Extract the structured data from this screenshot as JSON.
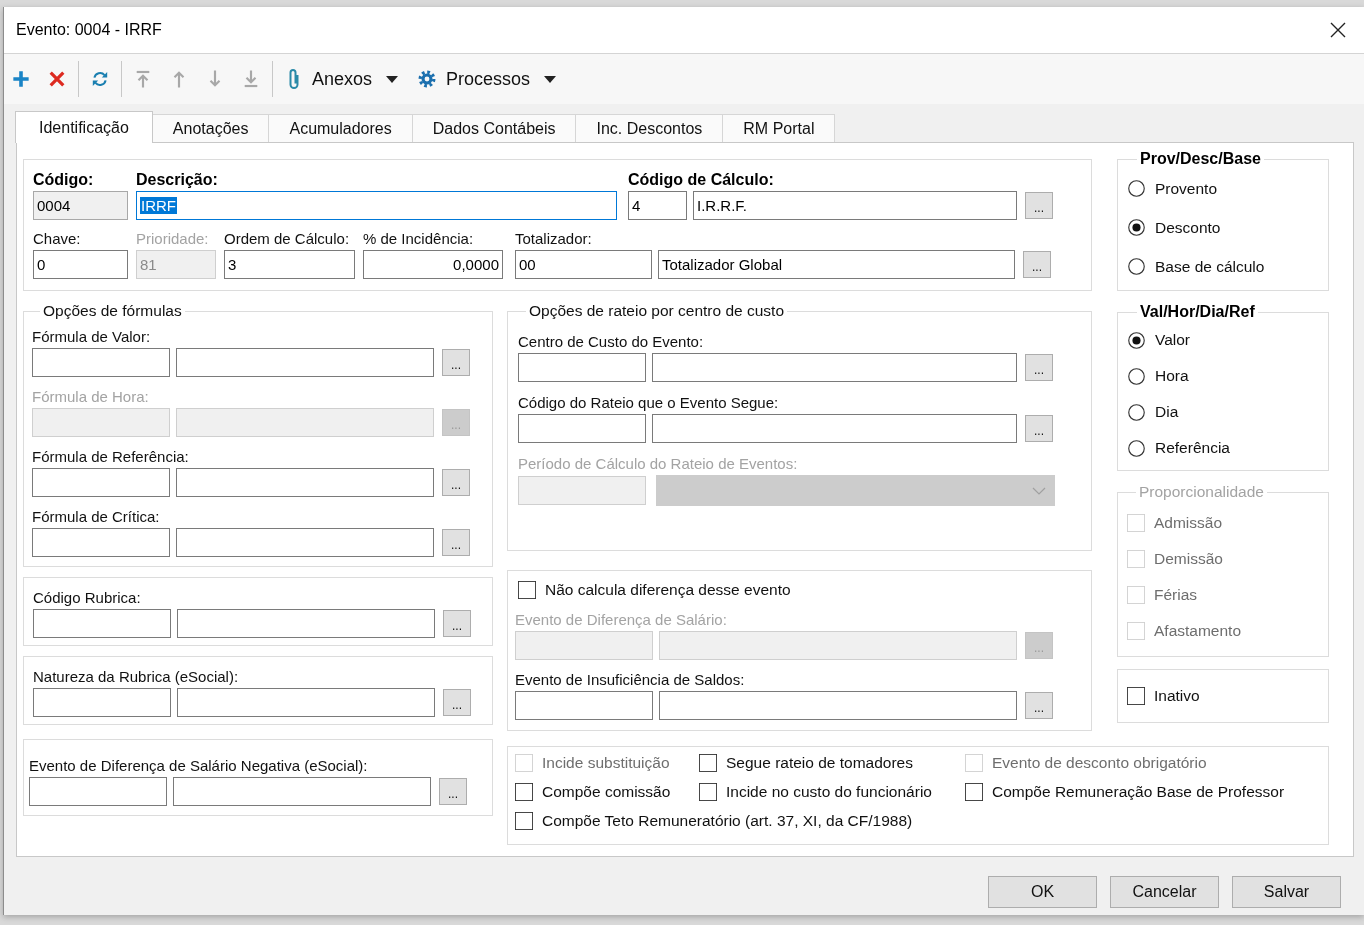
{
  "window": {
    "title": "Evento: 0004 - IRRF"
  },
  "toolbar": {
    "groups": [
      [
        {
          "kind": "add",
          "disabled": false
        },
        {
          "kind": "delete",
          "disabled": false
        }
      ],
      [
        {
          "kind": "refresh",
          "disabled": false
        }
      ],
      [
        {
          "kind": "move-first",
          "disabled": true
        },
        {
          "kind": "move-up",
          "disabled": true
        },
        {
          "kind": "move-down",
          "disabled": true
        },
        {
          "kind": "move-last",
          "disabled": true
        }
      ]
    ],
    "menus": [
      {
        "kind": "attachments",
        "label": "Anexos"
      },
      {
        "kind": "processes",
        "label": "Processos"
      }
    ]
  },
  "tabs": [
    {
      "label": "Identificação",
      "selected": true
    },
    {
      "label": "Anotações",
      "selected": false
    },
    {
      "label": "Acumuladores",
      "selected": false
    },
    {
      "label": "Dados Contábeis",
      "selected": false
    },
    {
      "label": "Inc. Descontos",
      "selected": false
    },
    {
      "label": "RM Portal",
      "selected": false
    }
  ],
  "identification": {
    "row_1": [
      {
        "kind": "text",
        "label": "Código:",
        "value": "0004",
        "readonly": true,
        "disabled": false
      },
      {
        "kind": "text",
        "label": "Descrição:",
        "value": "IRRF",
        "focused": true,
        "disabled": false
      },
      {
        "kind": "lookup",
        "label": "Código de Cálculo:",
        "code": "4",
        "description": "I.R.R.F.",
        "button": "...",
        "disabled": false
      }
    ],
    "row_2": [
      {
        "kind": "text",
        "label": "Chave:",
        "value": "0",
        "disabled": false
      },
      {
        "kind": "text",
        "label": "Prioridade:",
        "value": "81",
        "disabled": true
      },
      {
        "kind": "text",
        "label": "Ordem de Cálculo:",
        "value": "3",
        "disabled": false
      },
      {
        "kind": "number",
        "label": "% de Incidência:",
        "value": "0,0000",
        "disabled": false
      },
      {
        "kind": "lookup",
        "label": "Totalizador:",
        "code": "00",
        "description": "Totalizador Global",
        "button": "...",
        "disabled": false
      }
    ]
  },
  "left_groups": [
    {
      "title": "Opções de fórmulas",
      "fields": [
        {
          "kind": "lookup",
          "label": "Fórmula de Valor:",
          "button": "...",
          "disabled": false
        },
        {
          "kind": "lookup",
          "label": "Fórmula de Hora:",
          "button": "...",
          "disabled": true
        },
        {
          "kind": "lookup",
          "label": "Fórmula de Referência:",
          "button": "...",
          "disabled": false
        },
        {
          "kind": "lookup",
          "label": "Fórmula de Crítica:",
          "button": "...",
          "disabled": false
        }
      ]
    },
    {
      "fields": [
        {
          "kind": "lookup",
          "label": "Código Rubrica:",
          "button": "...",
          "disabled": false
        }
      ]
    },
    {
      "fields": [
        {
          "kind": "lookup",
          "label": "Natureza da Rubrica (eSocial):",
          "button": "...",
          "disabled": false
        }
      ]
    },
    {
      "fields": [
        {
          "kind": "lookup",
          "label": "Evento de Diferença de Salário Negativa (eSocial):",
          "button": "...",
          "disabled": false
        }
      ]
    }
  ],
  "middle_groups": [
    {
      "title": "Opções de rateio por centro de custo",
      "fields": [
        {
          "kind": "lookup",
          "label": "Centro de Custo do Evento:",
          "button": "...",
          "disabled": false
        },
        {
          "kind": "lookup",
          "label": "Código do Rateio que o Evento Segue:",
          "button": "...",
          "disabled": false
        },
        {
          "kind": "dropdown",
          "label": "Período de Cálculo do Rateio de Eventos:",
          "disabled": true
        }
      ]
    },
    {
      "checkbox": {
        "label": "Não calcula diferença desse evento",
        "checked": false
      },
      "fields": [
        {
          "kind": "lookup",
          "label": "Evento de Diferença de Salário:",
          "button": "...",
          "disabled": true
        },
        {
          "kind": "lookup",
          "label": "Evento de Insuficiência de Saldos:",
          "button": "...",
          "disabled": false
        }
      ]
    }
  ],
  "side_groups": [
    {
      "kind": "radio",
      "title": "Prov/Desc/Base",
      "disabled": false,
      "options": [
        {
          "label": "Provento",
          "selected": false
        },
        {
          "label": "Desconto",
          "selected": true
        },
        {
          "label": "Base de cálculo",
          "selected": false
        }
      ]
    },
    {
      "kind": "radio",
      "title": "Val/Hor/Dia/Ref",
      "disabled": false,
      "options": [
        {
          "label": "Valor",
          "selected": true
        },
        {
          "label": "Hora",
          "selected": false
        },
        {
          "label": "Dia",
          "selected": false
        },
        {
          "label": "Referência",
          "selected": false
        }
      ]
    },
    {
      "kind": "checkbox",
      "title": "Proporcionalidade",
      "disabled": true,
      "options": [
        {
          "label": "Admissão",
          "checked": false
        },
        {
          "label": "Demissão",
          "checked": false
        },
        {
          "label": "Férias",
          "checked": false
        },
        {
          "label": "Afastamento",
          "checked": false
        }
      ]
    },
    {
      "kind": "checkbox",
      "disabled": false,
      "options": [
        {
          "label": "Inativo",
          "checked": false
        }
      ]
    }
  ],
  "flags": [
    {
      "label": "Incide substituição",
      "checked": false,
      "disabled": true
    },
    {
      "label": "Segue rateio de tomadores",
      "checked": false,
      "disabled": false
    },
    {
      "label": "Evento de desconto obrigatório",
      "checked": false,
      "disabled": true
    },
    {
      "label": "Compõe comissão",
      "checked": false,
      "disabled": false
    },
    {
      "label": "Incide no custo do funcionário",
      "checked": false,
      "disabled": false
    },
    {
      "label": "Compõe Remuneração Base de Professor",
      "checked": false,
      "disabled": false
    },
    {
      "label": "Compõe Teto Remuneratório (art. 37, XI, da CF/1988)",
      "checked": false,
      "disabled": false
    }
  ],
  "footer_buttons": [
    "OK",
    "Cancelar",
    "Salvar"
  ]
}
